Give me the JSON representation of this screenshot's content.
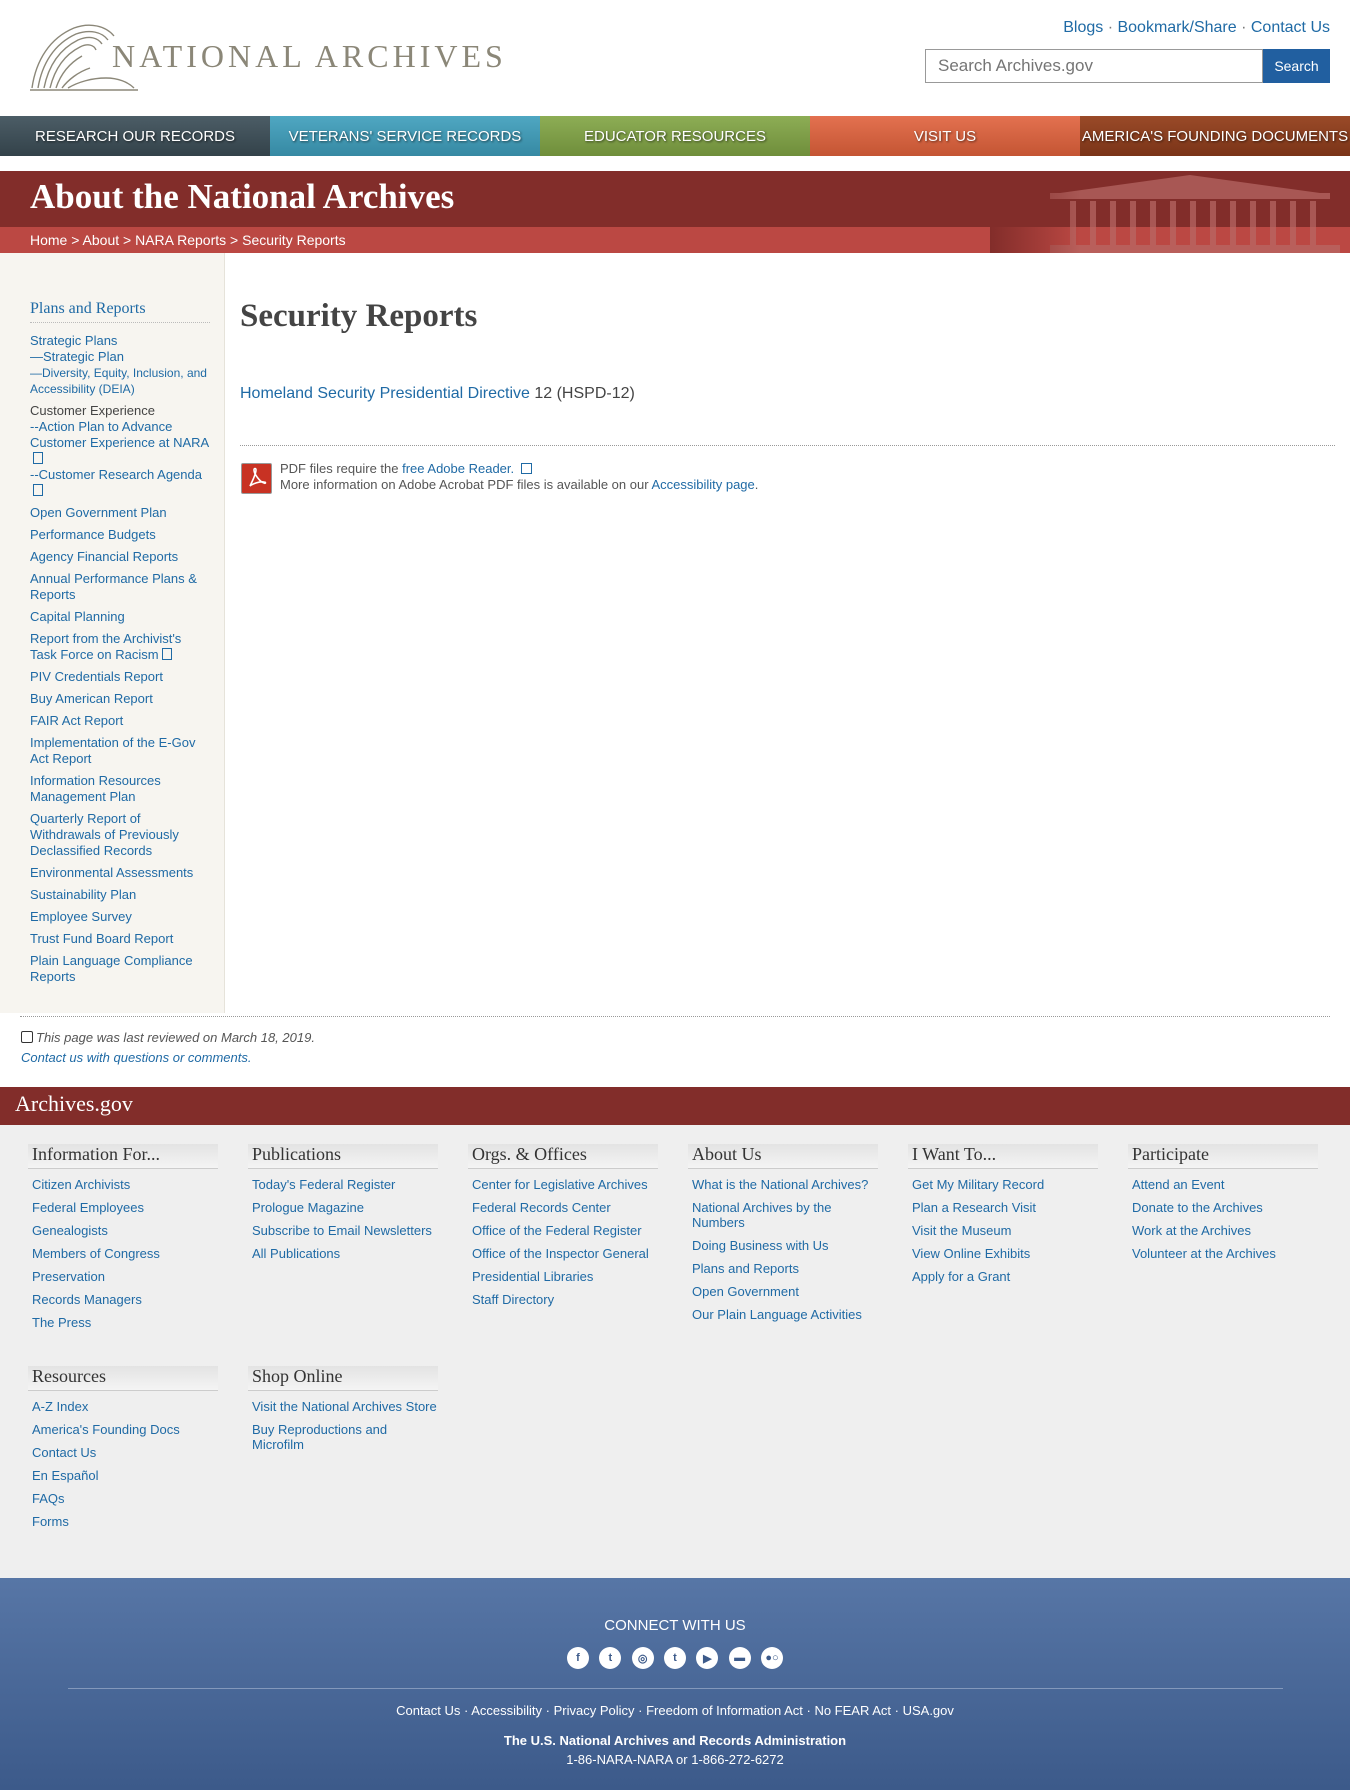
{
  "header": {
    "logo_text": "NATIONAL ARCHIVES",
    "top_links": [
      "Blogs",
      "Bookmark/Share",
      "Contact Us"
    ],
    "search_placeholder": "Search Archives.gov",
    "search_button": "Search"
  },
  "nav": [
    {
      "label": "Research Our Records",
      "color": "#3a4a52"
    },
    {
      "label": "Veterans' Service Records",
      "color": "#3f96b0"
    },
    {
      "label": "Educator Resources",
      "color": "#7d9d45"
    },
    {
      "label": "Visit Us",
      "color": "#d35f3c"
    },
    {
      "label": "America's Founding Documents",
      "color": "#8b3d1e"
    }
  ],
  "banner": {
    "title": "About the National Archives",
    "breadcrumb": [
      "Home",
      "About",
      "NARA Reports",
      "Security Reports"
    ]
  },
  "sidebar": {
    "heading": "Plans and Reports",
    "items": {
      "strategic_plans": "Strategic Plans",
      "strategic_plan": "—Strategic Plan",
      "deia": "—Diversity, Equity, Inclusion, and Accessibility (DEIA)",
      "cx": "Customer Experience",
      "cx_action": "--Action Plan to Advance Customer Experience at NARA",
      "cx_research": "--Customer Research Agenda",
      "open_gov": "Open Government Plan",
      "perf_budgets": "Performance Budgets",
      "agency_fin": "Agency Financial Reports",
      "annual_perf": "Annual Performance Plans & Reports",
      "capital": "Capital Planning",
      "racism": "Report from the Archivist's Task Force on Racism",
      "piv": "PIV Credentials Report",
      "buy_american": "Buy American Report",
      "fair": "FAIR Act Report",
      "egov": "Implementation of the E-Gov Act Report",
      "irm": "Information Resources Management Plan",
      "quarterly": "Quarterly Report of Withdrawals of Previously Declassified Records",
      "env": "Environmental Assessments",
      "sustain": "Sustainability Plan",
      "survey": "Employee Survey",
      "trust": "Trust Fund Board Report",
      "plain": "Plain Language Compliance Reports"
    }
  },
  "main": {
    "title": "Security Reports",
    "hspd_link": "Homeland Security Presidential Directive",
    "hspd_suffix": " 12 (HSPD-12)",
    "pdf_line1": "PDF files require the ",
    "pdf_link": "free Adobe Reader.",
    "pdf_line2": "More information on Adobe Acrobat PDF files is available on our ",
    "pdf_link2": "Accessibility page",
    "pdf_end": "."
  },
  "review": {
    "text": "This page was last reviewed on March 18, 2019.",
    "contact": "Contact us with questions or comments."
  },
  "footer": {
    "bar_title": "Archives.gov",
    "columns": [
      {
        "title": "Information For...",
        "links": [
          "Citizen Archivists",
          "Federal Employees",
          "Genealogists",
          "Members of Congress",
          "Preservation",
          "Records Managers",
          "The Press"
        ]
      },
      {
        "title": "Publications",
        "links": [
          "Today's Federal Register",
          "Prologue Magazine",
          "Subscribe to Email Newsletters",
          "All Publications"
        ]
      },
      {
        "title": "Orgs. & Offices",
        "links": [
          "Center for Legislative Archives",
          "Federal Records Center",
          "Office of the Federal Register",
          "Office of the Inspector General",
          "Presidential Libraries",
          "Staff Directory"
        ]
      },
      {
        "title": "About Us",
        "links": [
          "What is the National Archives?",
          "National Archives by the Numbers",
          "Doing Business with Us",
          "Plans and Reports",
          "Open Government",
          "Our Plain Language Activities"
        ]
      },
      {
        "title": "I Want To...",
        "links": [
          "Get My Military Record",
          "Plan a Research Visit",
          "Visit the Museum",
          "View Online Exhibits",
          "Apply for a Grant"
        ]
      },
      {
        "title": "Participate",
        "links": [
          "Attend an Event",
          "Donate to the Archives",
          "Work at the Archives",
          "Volunteer at the Archives"
        ]
      },
      {
        "title": "Resources",
        "links": [
          "A-Z Index",
          "America's Founding Docs",
          "Contact Us",
          "En Español",
          "FAQs",
          "Forms"
        ]
      },
      {
        "title": "Shop Online",
        "links": [
          "Visit the National Archives Store",
          "Buy Reproductions and Microfilm"
        ]
      }
    ],
    "connect": "CONNECT WITH US",
    "socials": [
      "facebook-icon",
      "twitter-icon",
      "instagram-icon",
      "tumblr-icon",
      "youtube-icon",
      "blog-icon",
      "flickr-icon"
    ],
    "bottom_links": [
      "Contact Us",
      "Accessibility",
      "Privacy Policy",
      "Freedom of Information Act",
      "No FEAR Act",
      "USA.gov"
    ],
    "org": "The U.S. National Archives and Records Administration",
    "phone": "1-86-NARA-NARA or 1-866-272-6272"
  }
}
